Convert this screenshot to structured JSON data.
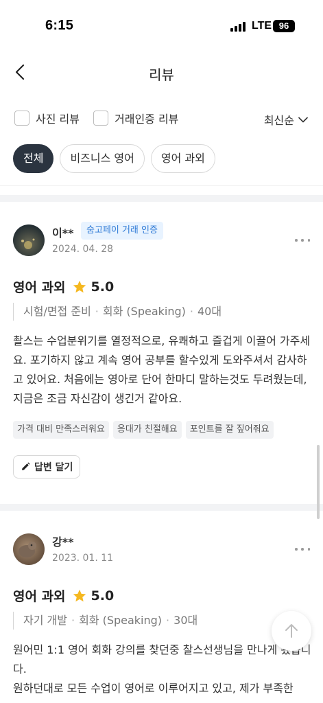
{
  "status_bar": {
    "time": "6:15",
    "network": "LTE",
    "battery": "96"
  },
  "header": {
    "title": "리뷰"
  },
  "filters": {
    "photo_review": "사진 리뷰",
    "verified_review": "거래인증 리뷰",
    "sort_label": "최신순"
  },
  "chips": [
    {
      "label": "전체",
      "active": true
    },
    {
      "label": "비즈니스 영어",
      "active": false
    },
    {
      "label": "영어 과외",
      "active": false
    }
  ],
  "reviews": [
    {
      "author": "이**",
      "badge": "숨고페이 거래 인증",
      "date": "2024. 04. 28",
      "service": "영어 과외",
      "rating": "5.0",
      "meta": [
        "시험/면접 준비",
        "회화 (Speaking)",
        "40대"
      ],
      "body": "촬스는 수업분위기를 열정적으로, 유쾌하고 즐겁게 이끌어 가주세요.  포기하지 않고 계속 영어 공부를 할수있게 도와주셔서 감사하고 있어요. 처음에는 영아로 단어 한마디 말하는것도 두려웠는데, 지금은 조금 자신감이 생긴거 같아요.",
      "tags": [
        "가격 대비 만족스러워요",
        "응대가 친절해요",
        "포인트를 잘 짚어줘요"
      ],
      "reply_label": "답변 달기"
    },
    {
      "author": "강**",
      "date": "2023. 01. 11",
      "service": "영어 과외",
      "rating": "5.0",
      "meta": [
        "자기 개발",
        "회화 (Speaking)",
        "30대"
      ],
      "body_lines": [
        "원어민 1:1 영어 회화 강의를 찾던중 찰스선생님을 만나게 됐습니다.",
        "원하던대로 모든 수업이 영어로 이루어지고 있고, 제가 부족한"
      ]
    }
  ],
  "colors": {
    "chip_active_bg": "#2b3440",
    "badge_bg": "#e8f3ff",
    "badge_text": "#2e7ad6",
    "star": "#f5b820"
  }
}
